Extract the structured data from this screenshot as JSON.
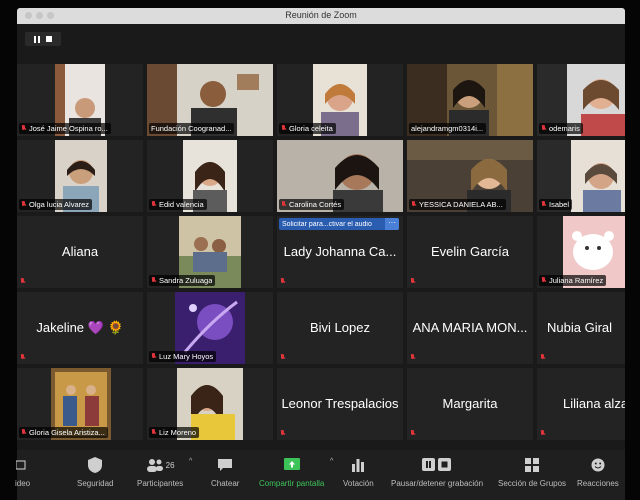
{
  "window": {
    "title": "Reunión de Zoom"
  },
  "participants": [
    {
      "name": "José Jaime Ospina ro...",
      "video": true,
      "muted": true
    },
    {
      "name": "Fundación Coogranad...",
      "video": true,
      "muted": false
    },
    {
      "name": "Gloria celeita",
      "video": true,
      "muted": true
    },
    {
      "name": "alejandramgm0314i...",
      "video": true,
      "muted": false,
      "active": true
    },
    {
      "name": "odemaris",
      "video": true,
      "muted": true
    },
    {
      "name": "Olga lucia Alvarez",
      "video": true,
      "muted": true
    },
    {
      "name": "Edid valencia",
      "video": true,
      "muted": true
    },
    {
      "name": "Carolina Cortés",
      "video": true,
      "muted": true
    },
    {
      "name": "YESSICA DANIELA AB...",
      "video": true,
      "muted": true
    },
    {
      "name": "Isabel",
      "video": true,
      "muted": true
    },
    {
      "name": "Aliana",
      "video": false,
      "muted": true
    },
    {
      "name": "Sandra Zuluaga",
      "video": true,
      "muted": true
    },
    {
      "name": "Lady Johanna Ca...",
      "video": false,
      "muted": true,
      "banner": "Solicitar para...ctivar el audio"
    },
    {
      "name": "Evelin García",
      "video": false,
      "muted": true
    },
    {
      "name": "Juliana Ramírez",
      "video": true,
      "muted": true
    },
    {
      "name": "Jakeline 💜 🌻",
      "video": false,
      "muted": true
    },
    {
      "name": "Luz Mary Hoyos",
      "video": true,
      "muted": true
    },
    {
      "name": "Bivi Lopez",
      "video": false,
      "muted": true
    },
    {
      "name": "ANA MARIA MON...",
      "video": false,
      "muted": true
    },
    {
      "name": "Nubia Giral",
      "video": false,
      "muted": true
    },
    {
      "name": "Gloria Gisela Aristiza...",
      "video": true,
      "muted": true
    },
    {
      "name": "Liz Moreno",
      "video": true,
      "muted": true
    },
    {
      "name": "Leonor Trespalacios",
      "video": false,
      "muted": true
    },
    {
      "name": "Margarita",
      "video": false,
      "muted": true
    },
    {
      "name": "Liliana alza",
      "video": false,
      "muted": true
    }
  ],
  "toolbar": {
    "video_label": "ideo",
    "security_label": "Seguridad",
    "participants_label": "Participantes",
    "participants_count": "26",
    "chat_label": "Chatear",
    "share_label": "Compartir pantalla",
    "poll_label": "Votación",
    "record_label": "Pausar/detener grabación",
    "breakout_label": "Sección de Grupos",
    "reactions_label": "Reacciones"
  },
  "colors": {
    "active_border": "#d8e25a",
    "muted_mic": "#e0353b",
    "share_green": "#3cc35a",
    "banner_blue": "#2a5db0"
  }
}
